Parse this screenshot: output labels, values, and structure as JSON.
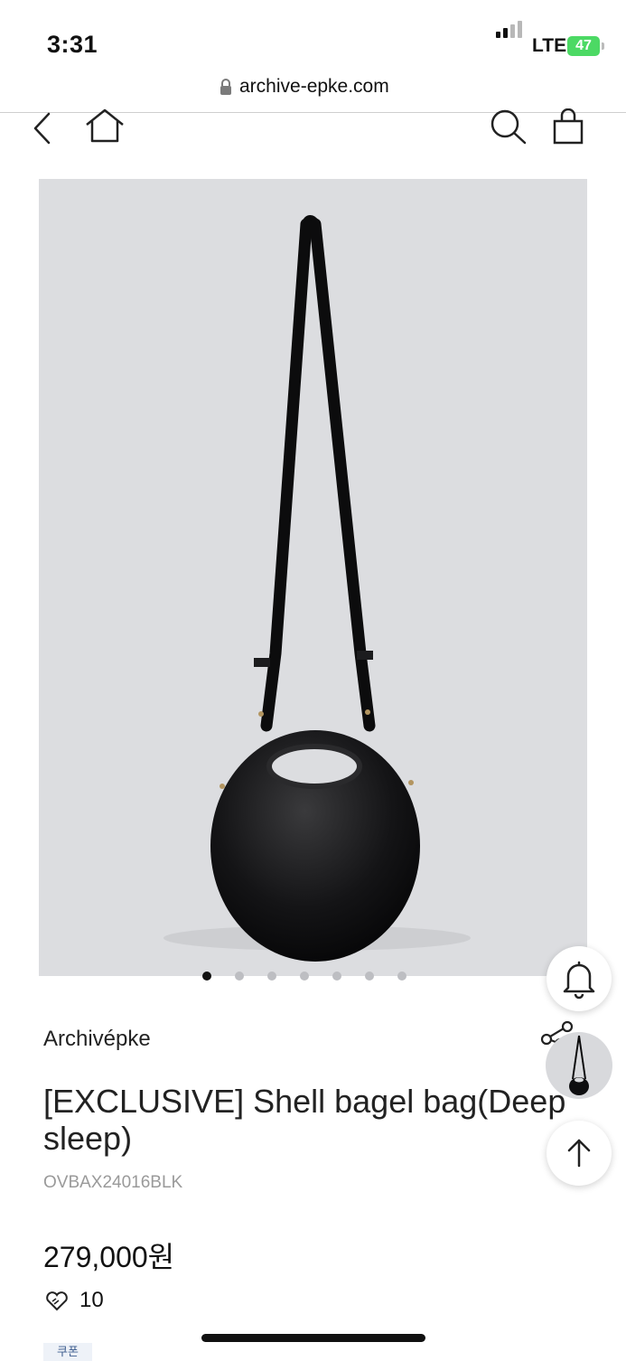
{
  "status_bar": {
    "time": "3:31",
    "network": "LTE",
    "battery": "47"
  },
  "browser": {
    "url": "archive-epke.com"
  },
  "nav": {
    "icons": [
      "back-icon",
      "home-icon",
      "search-icon",
      "shopping-bag-icon"
    ]
  },
  "gallery": {
    "dots_total": 7,
    "active_dot": 1
  },
  "product": {
    "brand": "Archivépke",
    "title": "[EXCLUSIVE] Shell bagel bag(Deep sleep)",
    "sku": "OVBAX24016BLK",
    "price": "279,000원",
    "likes": "10",
    "coupon_label": "쿠폰"
  },
  "floating": {
    "icons": [
      "bell-icon",
      "share-icon",
      "arrow-up-icon"
    ]
  },
  "colors": {
    "image_background": "#dcdde0",
    "battery": "#4cd964",
    "text": "#111111"
  }
}
